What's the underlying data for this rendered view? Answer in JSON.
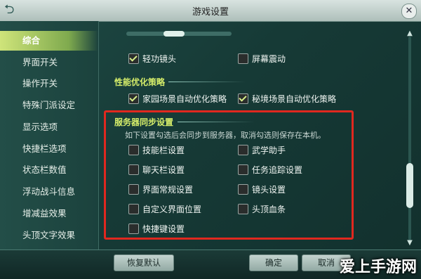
{
  "window": {
    "title": "游戏设置"
  },
  "sidebar": {
    "items": [
      {
        "label": "综合",
        "active": true
      },
      {
        "label": "界面开关"
      },
      {
        "label": "操作开关"
      },
      {
        "label": "特殊门派设定"
      },
      {
        "label": "显示选项"
      },
      {
        "label": "快捷栏选项"
      },
      {
        "label": "状态栏数值"
      },
      {
        "label": "浮动战斗信息"
      },
      {
        "label": "增减益效果"
      },
      {
        "label": "头顶文字效果"
      }
    ]
  },
  "content": {
    "top_checks": [
      {
        "label": "轻功镜头",
        "checked": true
      },
      {
        "label": "屏幕震动",
        "checked": false
      }
    ],
    "perf_section": {
      "title": "性能优化策略",
      "checks": [
        {
          "label": "家园场景自动优化策略",
          "checked": true
        },
        {
          "label": "秘境场景自动优化策略",
          "checked": true
        }
      ]
    },
    "sync_section": {
      "title": "服务器同步设置",
      "description": "如下设置勾选后会同步到服务器，取消勾选则保存在本机。",
      "checks": [
        {
          "label": "技能栏设置",
          "checked": false
        },
        {
          "label": "武学助手",
          "checked": false
        },
        {
          "label": "聊天栏设置",
          "checked": false
        },
        {
          "label": "任务追踪设置",
          "checked": false
        },
        {
          "label": "界面常规设置",
          "checked": false
        },
        {
          "label": "镜头设置",
          "checked": false
        },
        {
          "label": "自定义界面位置",
          "checked": false
        },
        {
          "label": "头顶血条",
          "checked": false
        },
        {
          "label": "快捷键设置",
          "checked": false
        }
      ]
    }
  },
  "buttons": {
    "restore_default": "恢复默认",
    "confirm": "确定",
    "cancel": "取消"
  },
  "watermark": "爱上手游网",
  "colors": {
    "accent": "#d6ee6a",
    "highlight_frame": "#e0281f",
    "check": "#d7f08a"
  }
}
